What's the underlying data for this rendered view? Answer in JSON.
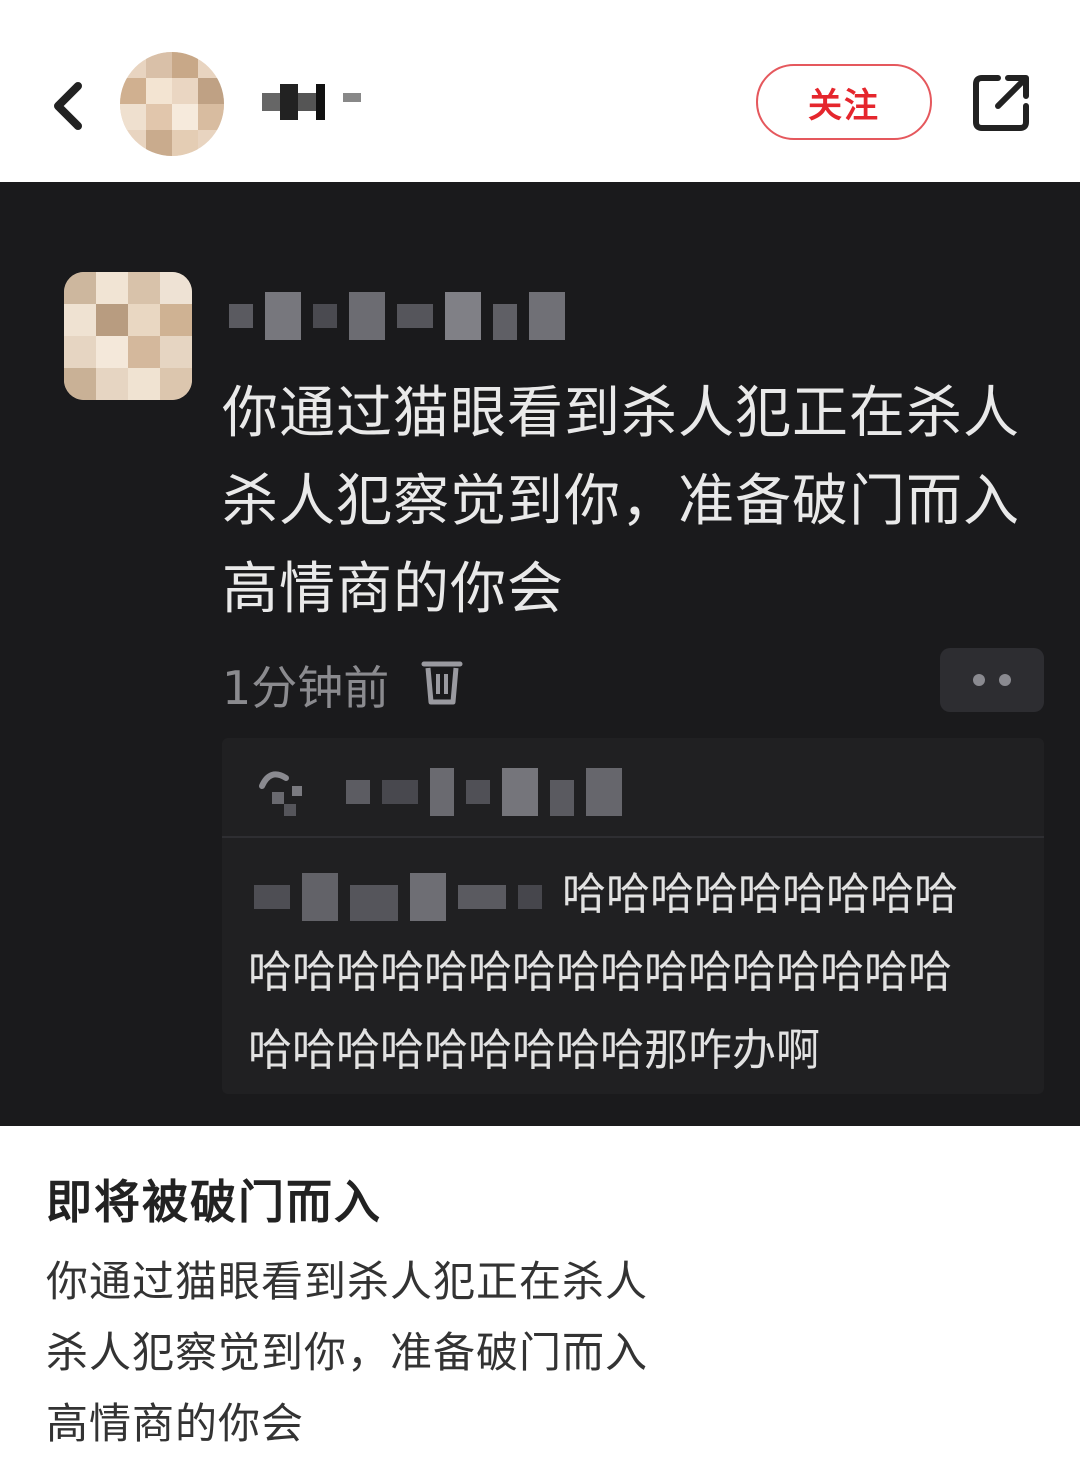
{
  "header": {
    "follow_label": "关注"
  },
  "comment": {
    "lines": [
      "你通过猫眼看到杀人犯正在杀人",
      "杀人犯察觉到你，准备破门而入",
      "高情商的你会"
    ],
    "time": "1分钟前"
  },
  "reply": {
    "lines": [
      "哈哈哈哈哈哈哈哈哈",
      "哈哈哈哈哈哈哈哈哈哈哈哈哈哈哈哈",
      "哈哈哈哈哈哈哈哈哈那咋办啊"
    ]
  },
  "post": {
    "title": "即将被破门而入",
    "body": [
      "你通过猫眼看到杀人犯正在杀人",
      "杀人犯察觉到你，准备破门而入",
      "高情商的你会"
    ]
  },
  "colors": {
    "accent": "#e5262d",
    "dark_bg": "#1a1a1c"
  },
  "icons": [
    "back-arrow-icon",
    "share-icon",
    "delete-icon",
    "more-icon",
    "reply-icon"
  ]
}
